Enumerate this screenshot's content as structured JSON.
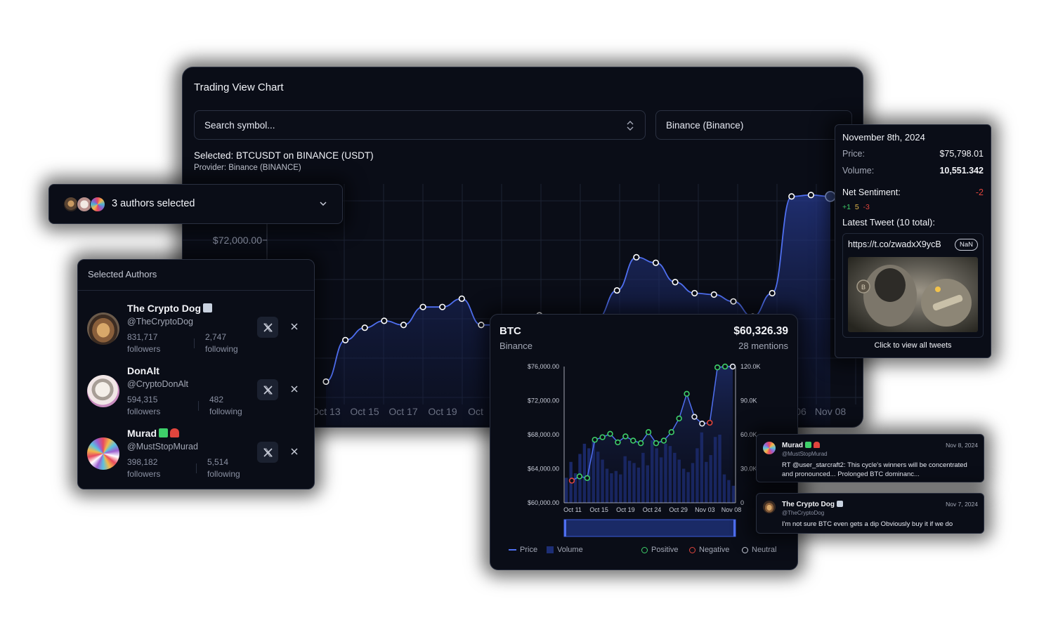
{
  "main_panel": {
    "title": "Trading View Chart",
    "search_placeholder": "Search symbol...",
    "exchange_value": "Binance (Binance)",
    "selected_line": "Selected: BTCUSDT on BINANCE (USDT)",
    "provider_line": "Provider: Binance (BINANCE)",
    "y_label": "$72,000.00",
    "x_labels": [
      "Oct 13",
      "Oct 15",
      "Oct 17",
      "Oct 19",
      "Oct",
      "06",
      "Nov 08"
    ]
  },
  "authors_dropdown": {
    "label": "3 authors selected"
  },
  "selected_authors": {
    "header": "Selected Authors",
    "authors": [
      {
        "name": "The Crypto Dog",
        "handle": "@TheCryptoDog",
        "followers": "831,717",
        "followers_label": "followers",
        "following": "2,747",
        "following_label": "following"
      },
      {
        "name": "DonAlt",
        "handle": "@CryptoDonAlt",
        "followers": "594,315",
        "followers_label": "followers",
        "following": "482",
        "following_label": "following"
      },
      {
        "name": "Murad",
        "handle": "@MustStopMurad",
        "followers": "398,182",
        "followers_label": "followers",
        "following": "5,514",
        "following_label": "following"
      }
    ]
  },
  "tooltip": {
    "date": "November 8th, 2024",
    "price_label": "Price:",
    "price_value": "$75,798.01",
    "volume_label": "Volume:",
    "volume_value": "10,551.342",
    "sentiment_label": "Net Sentiment:",
    "sentiment_value": "-2",
    "positive_count": "+1",
    "neutral_count": "5",
    "negative_count": "-3",
    "latest_tweet_label": "Latest Tweet (10 total):",
    "tweet_url": "https://t.co/zwadxX9ycB",
    "nan_badge": "NaN",
    "cta": "Click to view all tweets"
  },
  "btc_card": {
    "symbol": "BTC",
    "exchange": "Binance",
    "price": "$60,326.39",
    "mentions": "28 mentions",
    "legend": {
      "price": "Price",
      "volume": "Volume",
      "positive": "Positive",
      "negative": "Negative",
      "neutral": "Neutral"
    }
  },
  "tweets": [
    {
      "name": "Murad",
      "handle": "@MustStopMurad",
      "date": "Nov 8, 2024",
      "text": "RT @user_starcraft2: This cycle's winners will be concentrated and pronounced... Prolonged BTC dominanc..."
    },
    {
      "name": "The Crypto Dog",
      "handle": "@TheCryptoDog",
      "date": "Nov 7, 2024",
      "text": "I'm not sure BTC even gets a dip Obviously buy it if we do"
    }
  ],
  "colors": {
    "accent": "#3a5bd9",
    "positive": "#3ecf6a",
    "negative": "#e0453d",
    "neutral": "#c8ccd8",
    "background": "#0a0d17"
  },
  "chart_data": [
    {
      "type": "line",
      "title": "",
      "x_tick_labels": [
        "Oct 13",
        "Oct 15",
        "Oct 17",
        "Oct 19",
        "Oct",
        "06",
        "Nov 08"
      ],
      "y_tick_labels": [
        "$72,000.00"
      ],
      "series": [
        {
          "values": [
            62400,
            65400,
            66300,
            66800,
            66500,
            67800,
            67800,
            68400,
            66500,
            66500,
            65400,
            67200,
            65400,
            66100,
            67000,
            69000,
            71400,
            71000,
            69600,
            68800,
            68700,
            68200,
            67100,
            68800,
            75800,
            75900,
            75800
          ]
        }
      ],
      "grid": true
    },
    {
      "type": "line",
      "title": "",
      "y_left_ticks": [
        "$76,000.00",
        "$72,000.00",
        "$68,000.00",
        "$64,000.00",
        "$60,000.00"
      ],
      "y_right_ticks": [
        "120.0K",
        "90.0K",
        "60.0K",
        "30.0K",
        "0"
      ],
      "x_ticks": [
        "Oct 11",
        "Oct 15",
        "Oct 19",
        "Oct 24",
        "Oct 29",
        "Nov 03",
        "Nov 08"
      ],
      "ylim": [
        60000,
        76000
      ],
      "y2lim": [
        0,
        120000
      ],
      "series": [
        {
          "name": "Price",
          "type": "line",
          "sentiment": [
            "negative",
            "positive",
            "positive",
            "positive",
            "positive",
            "positive",
            "positive",
            "positive",
            "positive",
            "positive",
            "positive",
            "positive",
            "positive",
            "positive",
            "positive",
            "positive",
            "neutral",
            "neutral",
            "negative",
            "positive",
            "positive",
            "neutral"
          ],
          "values": [
            62600,
            63100,
            62900,
            67400,
            67700,
            68100,
            67100,
            67800,
            67300,
            67000,
            68300,
            67000,
            67300,
            68300,
            69900,
            72800,
            70100,
            69300,
            69400,
            75900,
            76000,
            76000
          ]
        },
        {
          "name": "Volume",
          "type": "bar",
          "values": [
            22000,
            36000,
            26000,
            43000,
            52000,
            48000,
            55000,
            45000,
            38000,
            30000,
            26000,
            28000,
            25000,
            41000,
            37000,
            35000,
            31000,
            44000,
            33000,
            55000,
            48000,
            40000,
            52000,
            50000,
            44000,
            38000,
            30000,
            27000,
            35000,
            48000,
            62000,
            36000,
            42000,
            58000,
            60000,
            25000,
            20000,
            15000
          ]
        }
      ]
    }
  ]
}
